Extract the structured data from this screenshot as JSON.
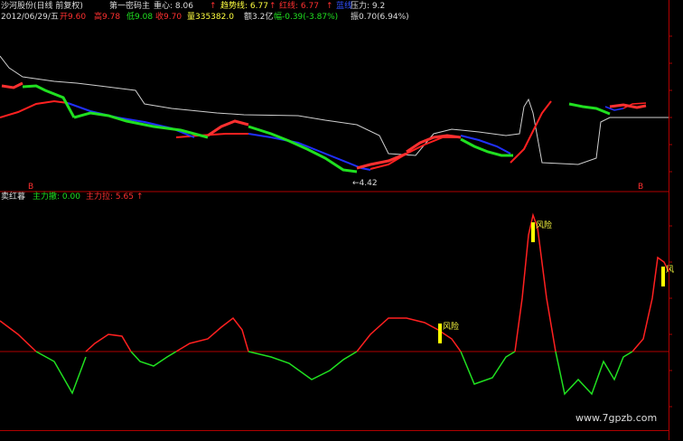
{
  "header": {
    "title": "沙河股份(日线 前复权)",
    "indicator_name": "第一密码主",
    "zhongxin_label": "重心: 8.06",
    "zhongxin_arrow": "↑",
    "qushixian_label": "趋势线: 6.77",
    "qushixian_arrow": "↑",
    "hongxian_label": "红线: 6.77",
    "hongxian_arrow": "↑",
    "lanxian_label": "蓝线",
    "yali_label": "压力: 9.2",
    "date": "2012/06/29/五",
    "open": "开9.60",
    "high": "高9.78",
    "low": "低9.08",
    "close": "收9.70",
    "volume": "量335382.0",
    "amount": "额3.2亿",
    "change": "幅-0.39(-3.87%)",
    "amplitude": "振0.70(6.94%)"
  },
  "main_chart": {
    "low_annotation": "←4.42",
    "left_marker": "B",
    "right_marker": "B"
  },
  "sub_chart": {
    "name": "卖红暮",
    "zhuli_che_label": "主力撤: 0.00",
    "zhuli_la_label": "主力拉: 5.65",
    "zhuli_la_arrow": "↑",
    "risk_labels": [
      "风险",
      "风险",
      "风"
    ]
  },
  "watermark": "www.7gpzb.com",
  "colors": {
    "background": "#000000",
    "up": "#ff3030",
    "down": "#20e020",
    "blue_line": "#2030ff",
    "white_line": "#cccccc",
    "risk_bar": "#ffff00",
    "axis": "#b00000"
  }
}
